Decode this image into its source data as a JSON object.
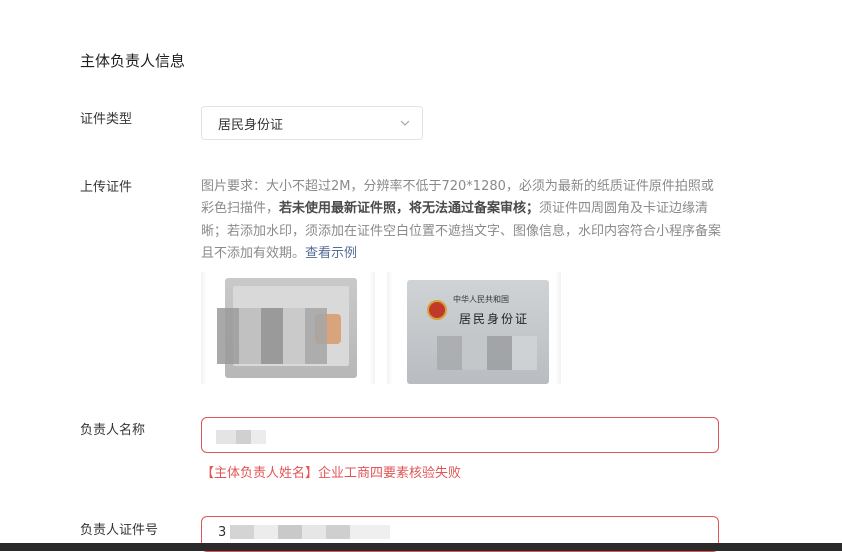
{
  "section_title": "主体负责人信息",
  "cert_type": {
    "label": "证件类型",
    "selected": "居民身份证"
  },
  "upload": {
    "label": "上传证件",
    "hint_part1": "图片要求：大小不超过2M，分辨率不低于720*1280，必须为最新的纸质证件原件拍照或彩色扫描件，",
    "hint_bold": "若未使用最新证件照，将无法通过备案审核；",
    "hint_part2": "须证件四周圆角及卡证边缘清晰；若添加水印，须添加在证件空白位置不遮挡文字、图像信息，水印内容符合小程序备案且不添加有效期。",
    "example_link": "查看示例",
    "card_back_text_top": "中华人民共和国",
    "card_back_text_main": "居民身份证"
  },
  "name_field": {
    "label": "负责人名称",
    "error": "【主体负责人姓名】企业工商四要素核验失败"
  },
  "id_field": {
    "label": "负责人证件号",
    "value_prefix": "3"
  }
}
